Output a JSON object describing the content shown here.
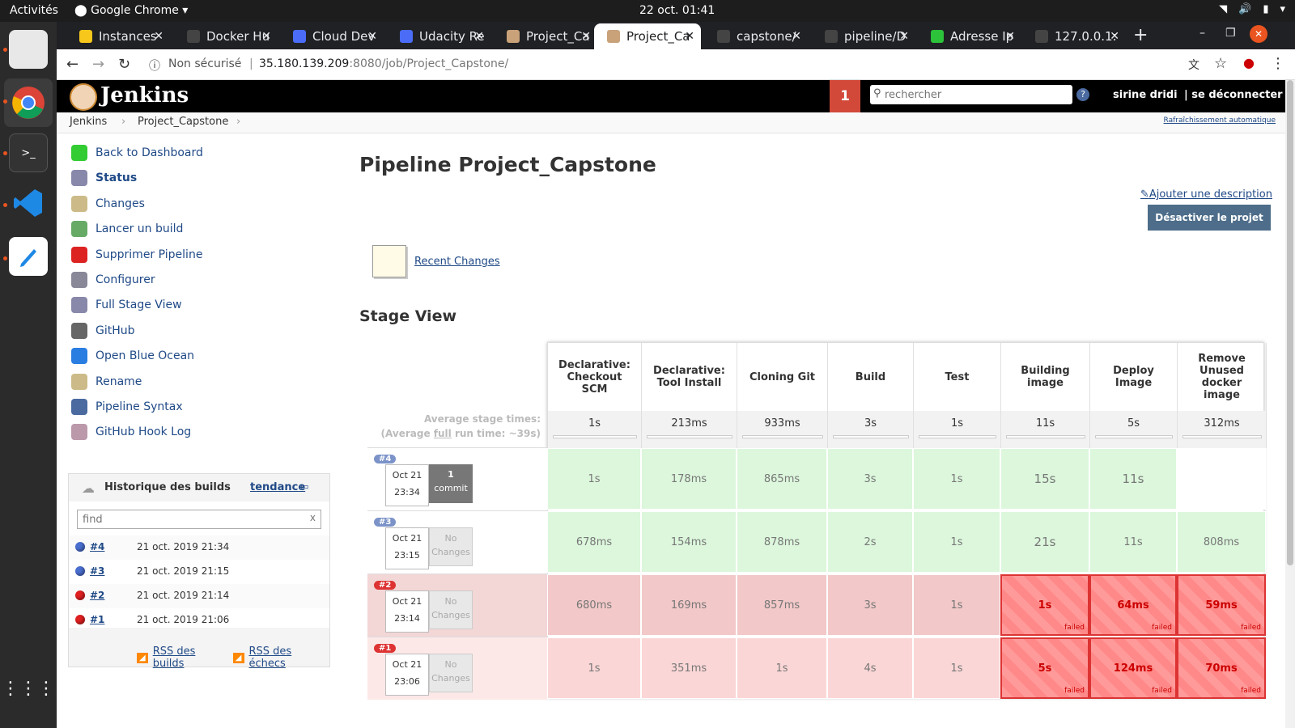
{
  "os": {
    "activities": "Activités",
    "app": "Google Chrome",
    "clock": "22 oct.  01:41"
  },
  "tabs": [
    {
      "label": "Instances",
      "color": "#f7c71b"
    },
    {
      "label": "Docker Hu",
      "color": "#444"
    },
    {
      "label": "Cloud Dev",
      "color": "#4a6cf7"
    },
    {
      "label": "Udacity Re",
      "color": "#4a6cf7"
    },
    {
      "label": "Project_Ca",
      "color": "#c9a27a"
    },
    {
      "label": "Project_Ca",
      "color": "#c9a27a"
    },
    {
      "label": "capstone/",
      "color": "#444"
    },
    {
      "label": "pipeline/D",
      "color": "#444"
    },
    {
      "label": "Adresse Ip",
      "color": "#2cc23a"
    },
    {
      "label": "127.0.0.1:",
      "color": "#444"
    }
  ],
  "url": {
    "security": "Non sécurisé",
    "host": "35.180.139.209",
    "path": ":8080/job/Project_Capstone/"
  },
  "header": {
    "brand": "Jenkins",
    "notif": "1",
    "search_placeholder": "rechercher",
    "help": "?",
    "user": "sirine dridi",
    "logout": "| se déconnecter"
  },
  "breadcrumb": {
    "root": "Jenkins",
    "job": "Project_Capstone",
    "autorefresh": "Rafraîchissement automatique"
  },
  "sidebar": {
    "tasks": [
      {
        "label": "Back to Dashboard",
        "icon": "up-arrow-icon",
        "color": "#3c3"
      },
      {
        "label": "Status",
        "icon": "search-icon",
        "color": "#88a"
      },
      {
        "label": "Changes",
        "icon": "notepad-icon",
        "color": "#cb8"
      },
      {
        "label": "Lancer un build",
        "icon": "clock-icon",
        "color": "#6a6"
      },
      {
        "label": "Supprimer Pipeline",
        "icon": "no-entry-icon",
        "color": "#d22"
      },
      {
        "label": "Configurer",
        "icon": "gear-icon",
        "color": "#889"
      },
      {
        "label": "Full Stage View",
        "icon": "search-icon",
        "color": "#88a"
      },
      {
        "label": "GitHub",
        "icon": "github-icon",
        "color": "#666"
      },
      {
        "label": "Open Blue Ocean",
        "icon": "blue-ocean-icon",
        "color": "#2a7de1"
      },
      {
        "label": "Rename",
        "icon": "notepad-icon",
        "color": "#cb8"
      },
      {
        "label": "Pipeline Syntax",
        "icon": "help-icon",
        "color": "#4a6aa0"
      },
      {
        "label": "GitHub Hook Log",
        "icon": "clipboard-icon",
        "color": "#b9a"
      }
    ]
  },
  "history": {
    "title": "Historique des builds",
    "trend": "tendance",
    "find_placeholder": "find",
    "clear": "x",
    "builds": [
      {
        "id": "#4",
        "date": "21 oct. 2019 21:34",
        "status": "blue"
      },
      {
        "id": "#3",
        "date": "21 oct. 2019 21:15",
        "status": "blue"
      },
      {
        "id": "#2",
        "date": "21 oct. 2019 21:14",
        "status": "red"
      },
      {
        "id": "#1",
        "date": "21 oct. 2019 21:06",
        "status": "red"
      }
    ],
    "rss_all": "RSS des builds",
    "rss_fail": "RSS des échecs"
  },
  "main": {
    "title": "Pipeline Project_Capstone",
    "add_desc": "Ajouter une description",
    "disable": "Désactiver le projet",
    "recent_changes": "Recent Changes",
    "stage_view": "Stage View",
    "avg_label1": "Average stage times:",
    "avg_label2a": "(Average ",
    "avg_label2b": "full",
    "avg_label2c": " run time: ~39s)"
  },
  "stages": [
    {
      "name": "Declarative: Checkout SCM",
      "avg": "1s"
    },
    {
      "name": "Declarative: Tool Install",
      "avg": "213ms"
    },
    {
      "name": "Cloning Git",
      "avg": "933ms"
    },
    {
      "name": "Build",
      "avg": "3s"
    },
    {
      "name": "Test",
      "avg": "1s"
    },
    {
      "name": "Building image",
      "avg": "11s"
    },
    {
      "name": "Deploy Image",
      "avg": "5s"
    },
    {
      "name": "Remove Unused docker image",
      "avg": "312ms"
    }
  ],
  "runs": [
    {
      "id": "#4",
      "date": "Oct 21",
      "time": "23:34",
      "changes": "1",
      "changes_sub": "commit",
      "ok": true,
      "cells": [
        "1s",
        "178ms",
        "865ms",
        "3s",
        "1s",
        "15s",
        "11s",
        ""
      ]
    },
    {
      "id": "#3",
      "date": "Oct 21",
      "time": "23:15",
      "changes": "No",
      "changes_sub": "Changes",
      "ok": true,
      "cells": [
        "678ms",
        "154ms",
        "878ms",
        "2s",
        "1s",
        "21s",
        "11s",
        "808ms"
      ]
    },
    {
      "id": "#2",
      "date": "Oct 21",
      "time": "23:14",
      "changes": "No",
      "changes_sub": "Changes",
      "ok": false,
      "cells": [
        "680ms",
        "169ms",
        "857ms",
        "3s",
        "1s",
        "1s",
        "64ms",
        "59ms"
      ],
      "failed_from": 5
    },
    {
      "id": "#1",
      "date": "Oct 21",
      "time": "23:06",
      "changes": "No",
      "changes_sub": "Changes",
      "ok": false,
      "cells": [
        "1s",
        "351ms",
        "1s",
        "4s",
        "1s",
        "5s",
        "124ms",
        "70ms"
      ],
      "failed_from": 5
    }
  ],
  "failed_label": "failed"
}
